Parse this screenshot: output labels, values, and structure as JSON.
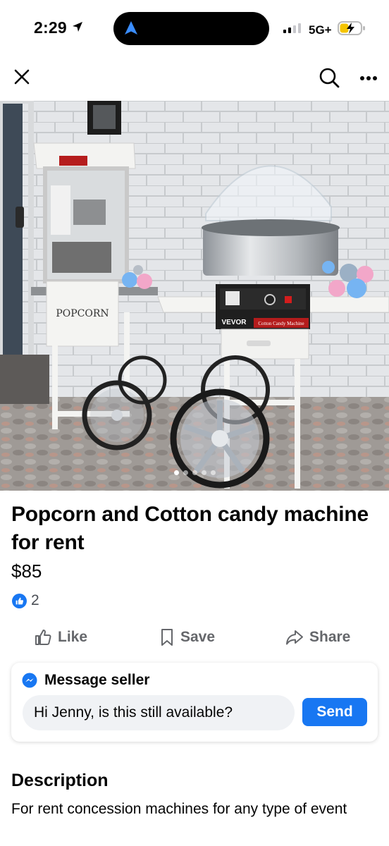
{
  "status_bar": {
    "time": "2:29",
    "network": "5G+",
    "icons": [
      "location-arrow-icon",
      "signal-icon",
      "battery-charging-icon"
    ]
  },
  "nav": {
    "icons": [
      "close-icon",
      "search-icon",
      "more-icon"
    ]
  },
  "photo": {
    "left_machine_label": "POPCORN",
    "right_machine_brand": "VEVOR",
    "right_machine_panel_text": "Cotton Candy Machine",
    "carousel_count": 5,
    "carousel_active": 0
  },
  "listing": {
    "title": "Popcorn and Cotton candy machine for rent",
    "price": "$85",
    "reaction_count": "2"
  },
  "actions": {
    "like_label": "Like",
    "save_label": "Save",
    "share_label": "Share"
  },
  "message": {
    "header": "Message seller",
    "input_value": "Hi Jenny, is this still available?",
    "send_label": "Send"
  },
  "description": {
    "heading": "Description",
    "body": "For rent concession machines for any type of event"
  },
  "colors": {
    "accent": "#1877f2",
    "text_primary": "#050505",
    "text_secondary": "#65676b",
    "input_bg": "#f0f2f5"
  }
}
